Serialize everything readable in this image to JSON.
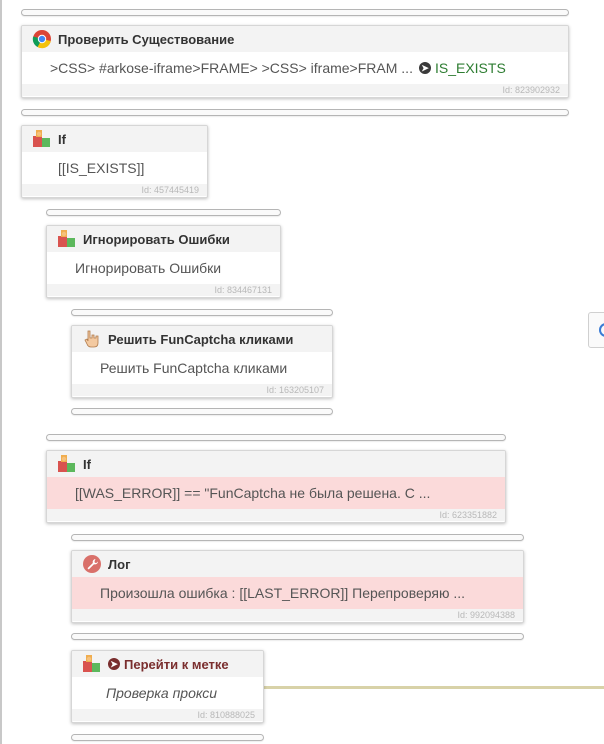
{
  "blocks": [
    {
      "title": "Проверить Существование",
      "icon": "chrome-icon",
      "body_text": ">CSS> #arkose-iframe>FRAME> >CSS> iframe>FRAM ...",
      "body_var": "IS_EXISTS",
      "id_label": "Id: 823902932"
    },
    {
      "title": "If",
      "icon": "puzzle-icon",
      "body_text": "[[IS_EXISTS]]",
      "id_label": "Id: 457445419"
    },
    {
      "title": "Игнорировать Ошибки",
      "icon": "puzzle-icon",
      "body_text": "Игнорировать Ошибки",
      "id_label": "Id: 834467131"
    },
    {
      "title": "Решить FunCaptcha кликами",
      "icon": "pointer-hand-icon",
      "body_text": "Решить FunCaptcha кликами",
      "id_label": "Id: 163205107"
    },
    {
      "title": "If",
      "icon": "puzzle-icon",
      "body_text": "[[WAS_ERROR]] == \"FunCaptcha не была решена. С ...",
      "id_label": "Id: 623351882"
    },
    {
      "title": "Лог",
      "icon": "wrench-icon",
      "body_text": "Произошла ошибка : [[LAST_ERROR]] Перепроверяю ...",
      "id_label": "Id: 992094388"
    },
    {
      "title": "Перейти к метке",
      "icon": "puzzle-icon",
      "body_text": "Проверка прокси",
      "id_label": "Id: 810888025"
    }
  ],
  "colors": {
    "error_bg": "#fbdada",
    "variable": "#2e7d32",
    "goto_title": "#7a2e2e",
    "goto_line": "#d8d2a8"
  }
}
